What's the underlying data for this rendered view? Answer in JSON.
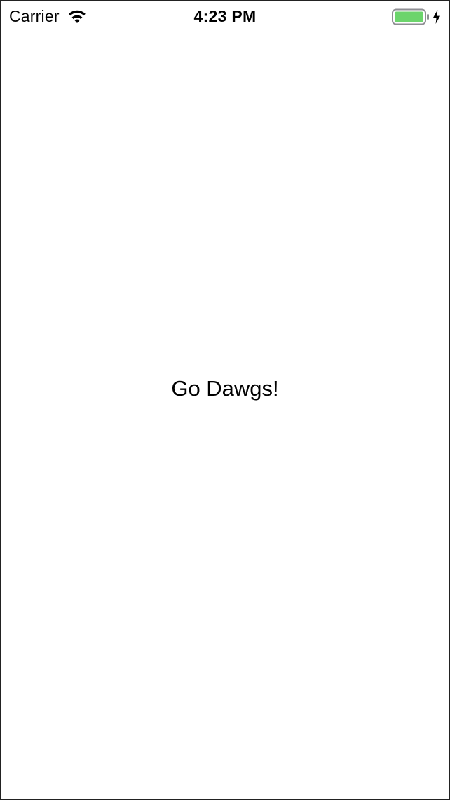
{
  "status_bar": {
    "carrier": "Carrier",
    "time": "4:23 PM",
    "wifi_icon": "wifi-icon",
    "battery_icon": "battery-icon",
    "charging_icon": "charging-bolt-icon",
    "battery_level": 1.0,
    "battery_color": "#6cd46c"
  },
  "main": {
    "label": "Go Dawgs!"
  }
}
